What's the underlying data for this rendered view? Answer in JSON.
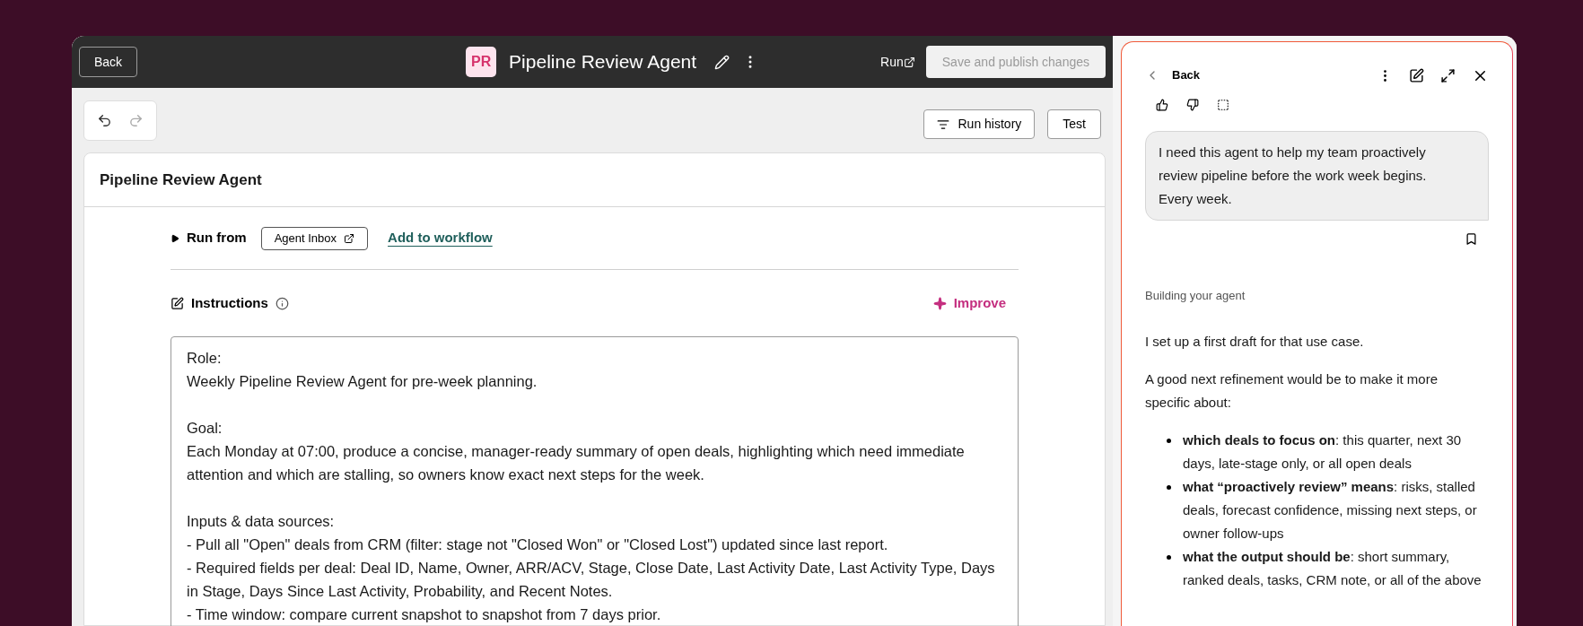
{
  "top_bar": {
    "back": "Back",
    "avatar": "PR",
    "title": "Pipeline Review Agent",
    "run_link": "Run",
    "publish": {
      "label": "Save and publish changes",
      "disabled": true
    }
  },
  "toolbar": {
    "undo_disabled": false,
    "redo_disabled": true,
    "run_history": "Run history",
    "test": "Test"
  },
  "card": {
    "title": "Pipeline Review Agent",
    "run_from": {
      "label": "Run from",
      "expanded": false,
      "inbox": "Agent Inbox",
      "workflow_link": "Add to workflow"
    },
    "instructions": {
      "label": "Instructions",
      "improve": "Improve",
      "sections": [
        [
          "Role:",
          "Weekly Pipeline Review Agent for pre-week planning."
        ],
        [
          "Goal:",
          "Each Monday at 07:00, produce a concise, manager-ready summary of open deals, highlighting which need immediate attention and which are stalling, so owners know exact next steps for the week."
        ],
        [
          "Inputs & data sources:",
          "- Pull all \"Open\" deals from CRM (filter: stage not \"Closed Won\" or \"Closed Lost\") updated since last report.",
          "- Required fields per deal: Deal ID, Name, Owner, ARR/ACV, Stage, Close Date, Last Activity Date, Last Activity Type, Days in Stage, Days Since Last Activity, Probability, and Recent Notes.",
          "- Time window: compare current snapshot to snapshot from 7 days prior."
        ]
      ]
    }
  },
  "assistant": {
    "back": "Back",
    "user_message": "I need this agent to help my team proactively review pipeline before the work week begins. Every week.",
    "status": "Building your agent",
    "paragraphs": [
      "I set up a first draft for that use case.",
      "A good next refinement would be to make it more specific about:"
    ],
    "bullets": [
      "**which deals to focus on**: this quarter, next 30 days, late-stage only, or all open deals",
      "**what “proactively review” means**: risks, stalled deals, forecast confidence, missing next steps, or owner follow-ups",
      "**what the output should be**: short summary, ranked deals, tasks, CRM note, or all of the above"
    ]
  }
}
